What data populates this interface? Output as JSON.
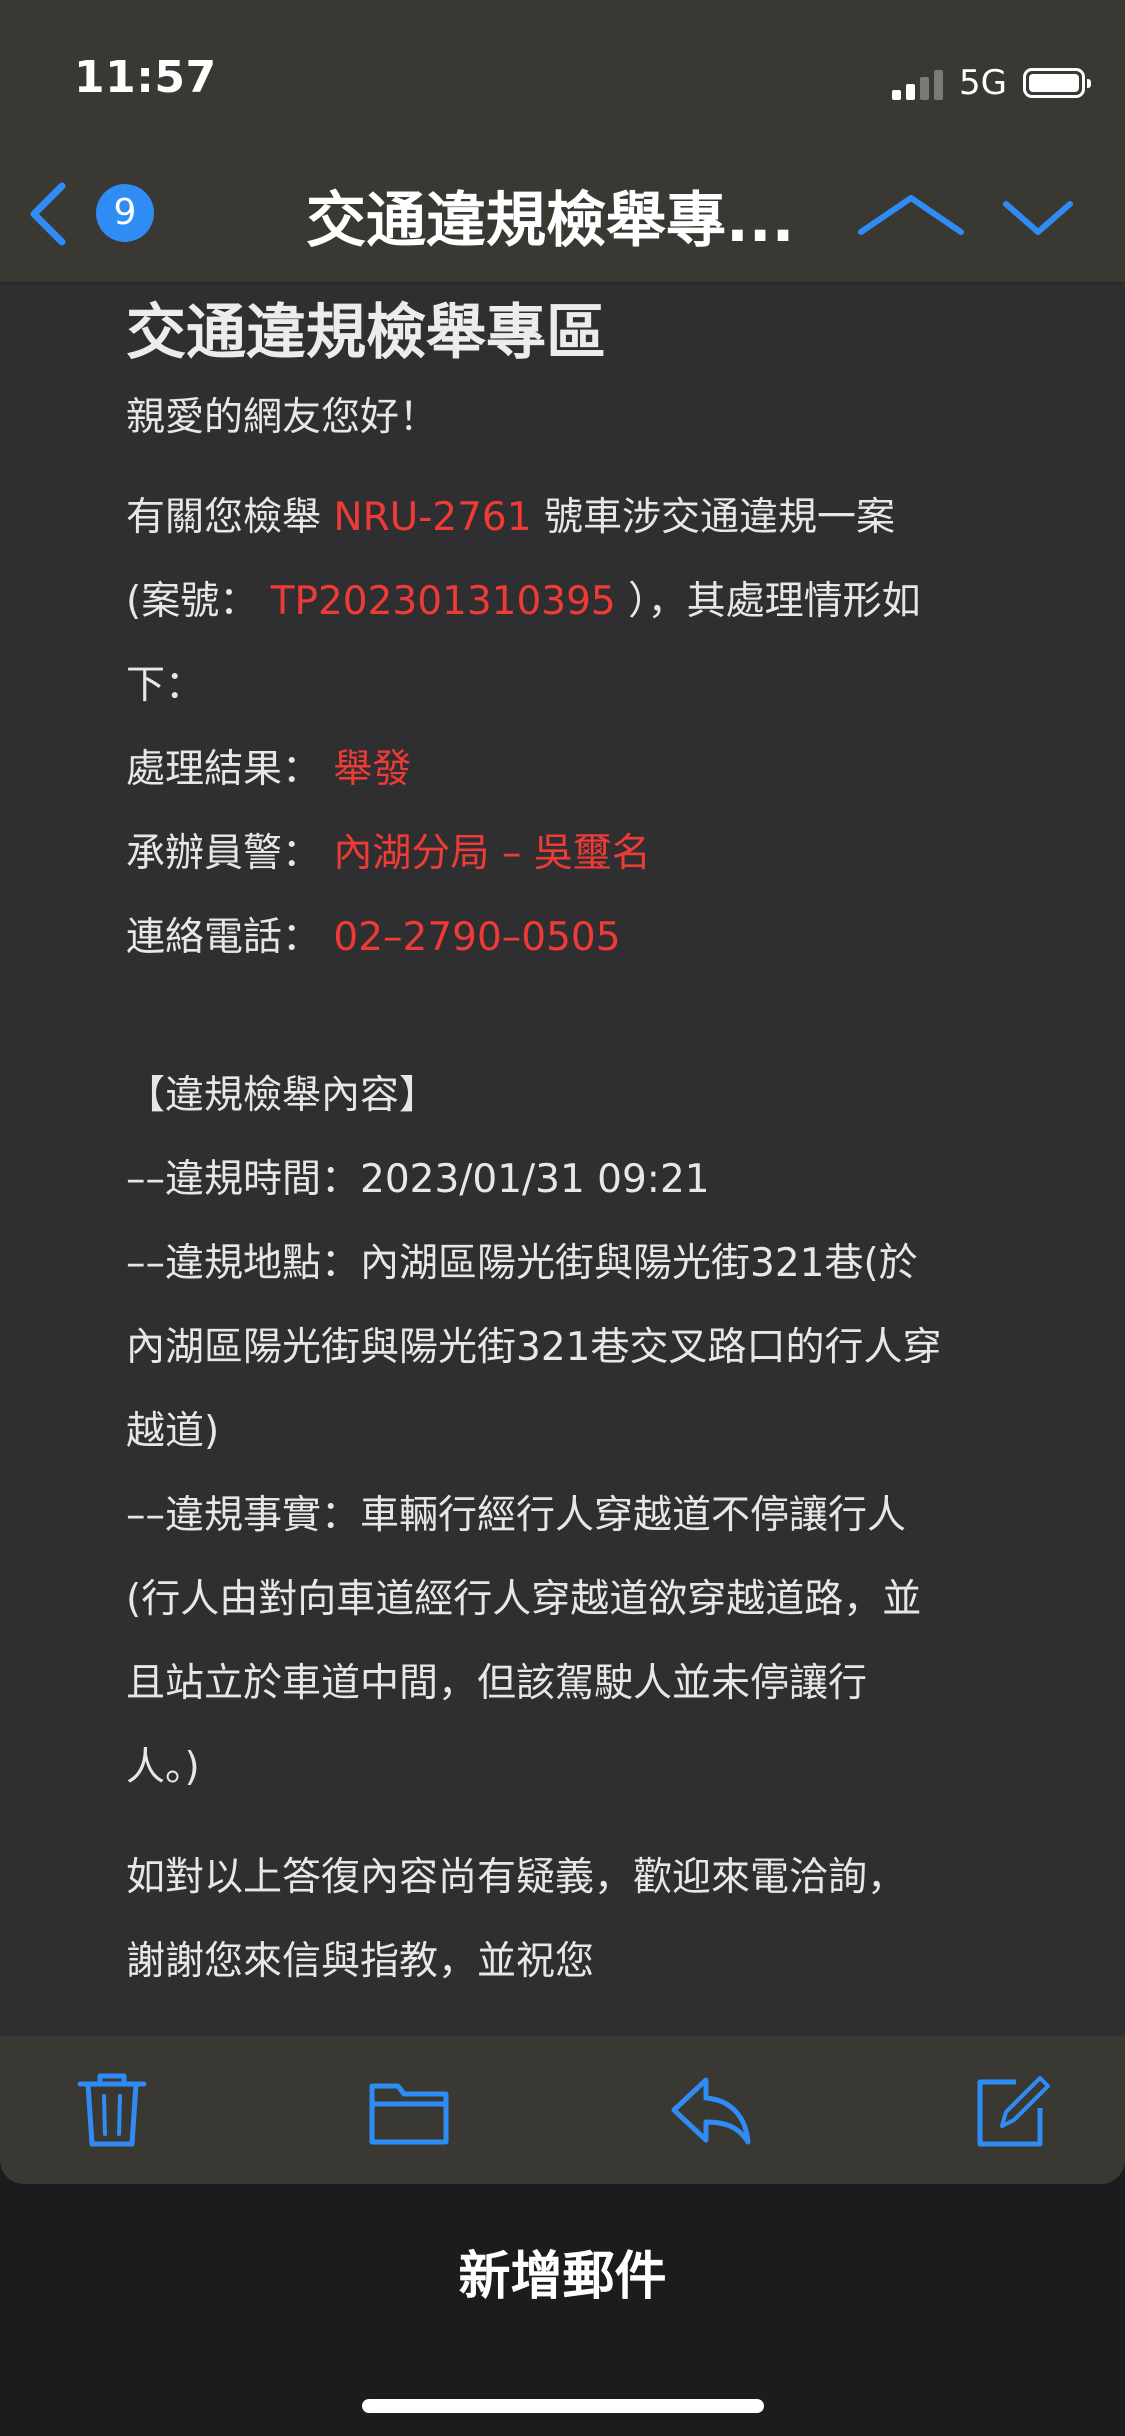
{
  "status_bar": {
    "time": "11:57",
    "network": "5G"
  },
  "nav": {
    "badge_count": "9",
    "title": "交通違規檢舉專..."
  },
  "mail": {
    "heading": "交通違規檢舉專區",
    "greeting": "親愛的網友您好！",
    "intro": {
      "p1": "有關您檢舉 ",
      "plate": "NRU-2761",
      "p2": " 號車涉交通違規一案",
      "p3": "(案號：",
      "case_no": "TP202301310395",
      "p4": "），其處理情形如",
      "p5": "下："
    },
    "result_label": "處理結果：",
    "result_value": "舉發",
    "officer_label": "承辦員警：",
    "officer_value": "內湖分局 – 吳璽名",
    "phone_label": "連絡電話：",
    "phone_value": "02–2790–0505",
    "section_title": "【違規檢舉內容】",
    "details": [
      "––違規時間：2023/01/31 09:21",
      "––違規地點：內湖區陽光街與陽光街321巷(於",
      "內湖區陽光街與陽光街321巷交叉路口的行人穿",
      "越道)",
      "––違規事實：車輛行經行人穿越道不停讓行人",
      "(行人由對向車道經行人穿越道欲穿越道路，並",
      "且站立於車道中間，但該駕駛人並未停讓行",
      "人。)"
    ],
    "closing": [
      "如對以上答復內容尚有疑義，歡迎來電洽詢，",
      "謝謝您來信與指教，並祝您"
    ]
  },
  "toolbar": {
    "icons": [
      "trash-icon",
      "folder-icon",
      "reply-icon",
      "compose-icon"
    ],
    "accent_color": "#2f8cf5"
  },
  "sheet": {
    "title": "新增郵件"
  }
}
